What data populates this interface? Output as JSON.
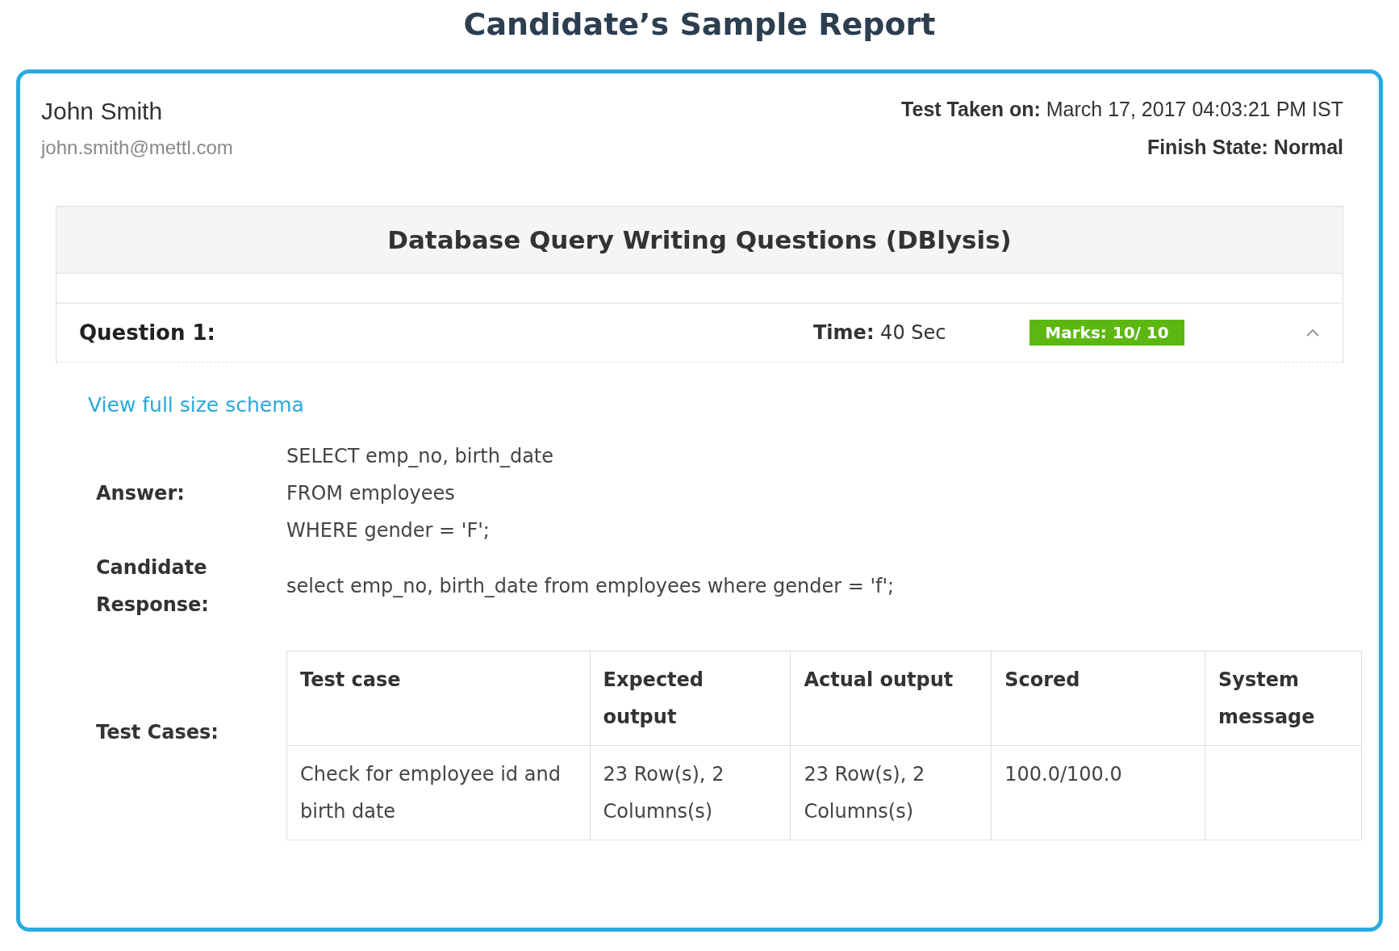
{
  "title": "Candidate’s Sample Report",
  "candidate": {
    "name": "John Smith",
    "email": "john.smith@mettl.com"
  },
  "test_info": [
    {
      "text": "**Test Taken on:** March 17, 2017 04:03:21 PM IST",
      "bold": false
    },
    {
      "text": "Finish State: Normal",
      "bold": true
    }
  ],
  "section": {
    "title": "Database Query Writing Questions (DBlysis)",
    "question": {
      "label": "Question 1:",
      "time": "**Time:** 40 Sec",
      "marks": "Marks: 10/ 10",
      "expanded": true
    },
    "schema_link": "View full size schema",
    "answer": {
      "label": "Answer:",
      "lines": [
        "SELECT emp_no, birth_date",
        "FROM employees",
        "WHERE gender = 'F';"
      ]
    },
    "response": {
      "label": "Candidate Response:",
      "text": "select emp_no, birth_date from employees where gender = 'f';"
    },
    "test_cases": {
      "label": "Test Cases:",
      "columns": [
        "Test case",
        "Expected output",
        "Actual output",
        "Scored",
        "System message"
      ],
      "rows": [
        [
          "Check for employee id and birth date",
          "23 Row(s), 2 Columns(s)",
          "23 Row(s), 2 Columns(s)",
          "100.0/100.0",
          ""
        ]
      ]
    }
  }
}
